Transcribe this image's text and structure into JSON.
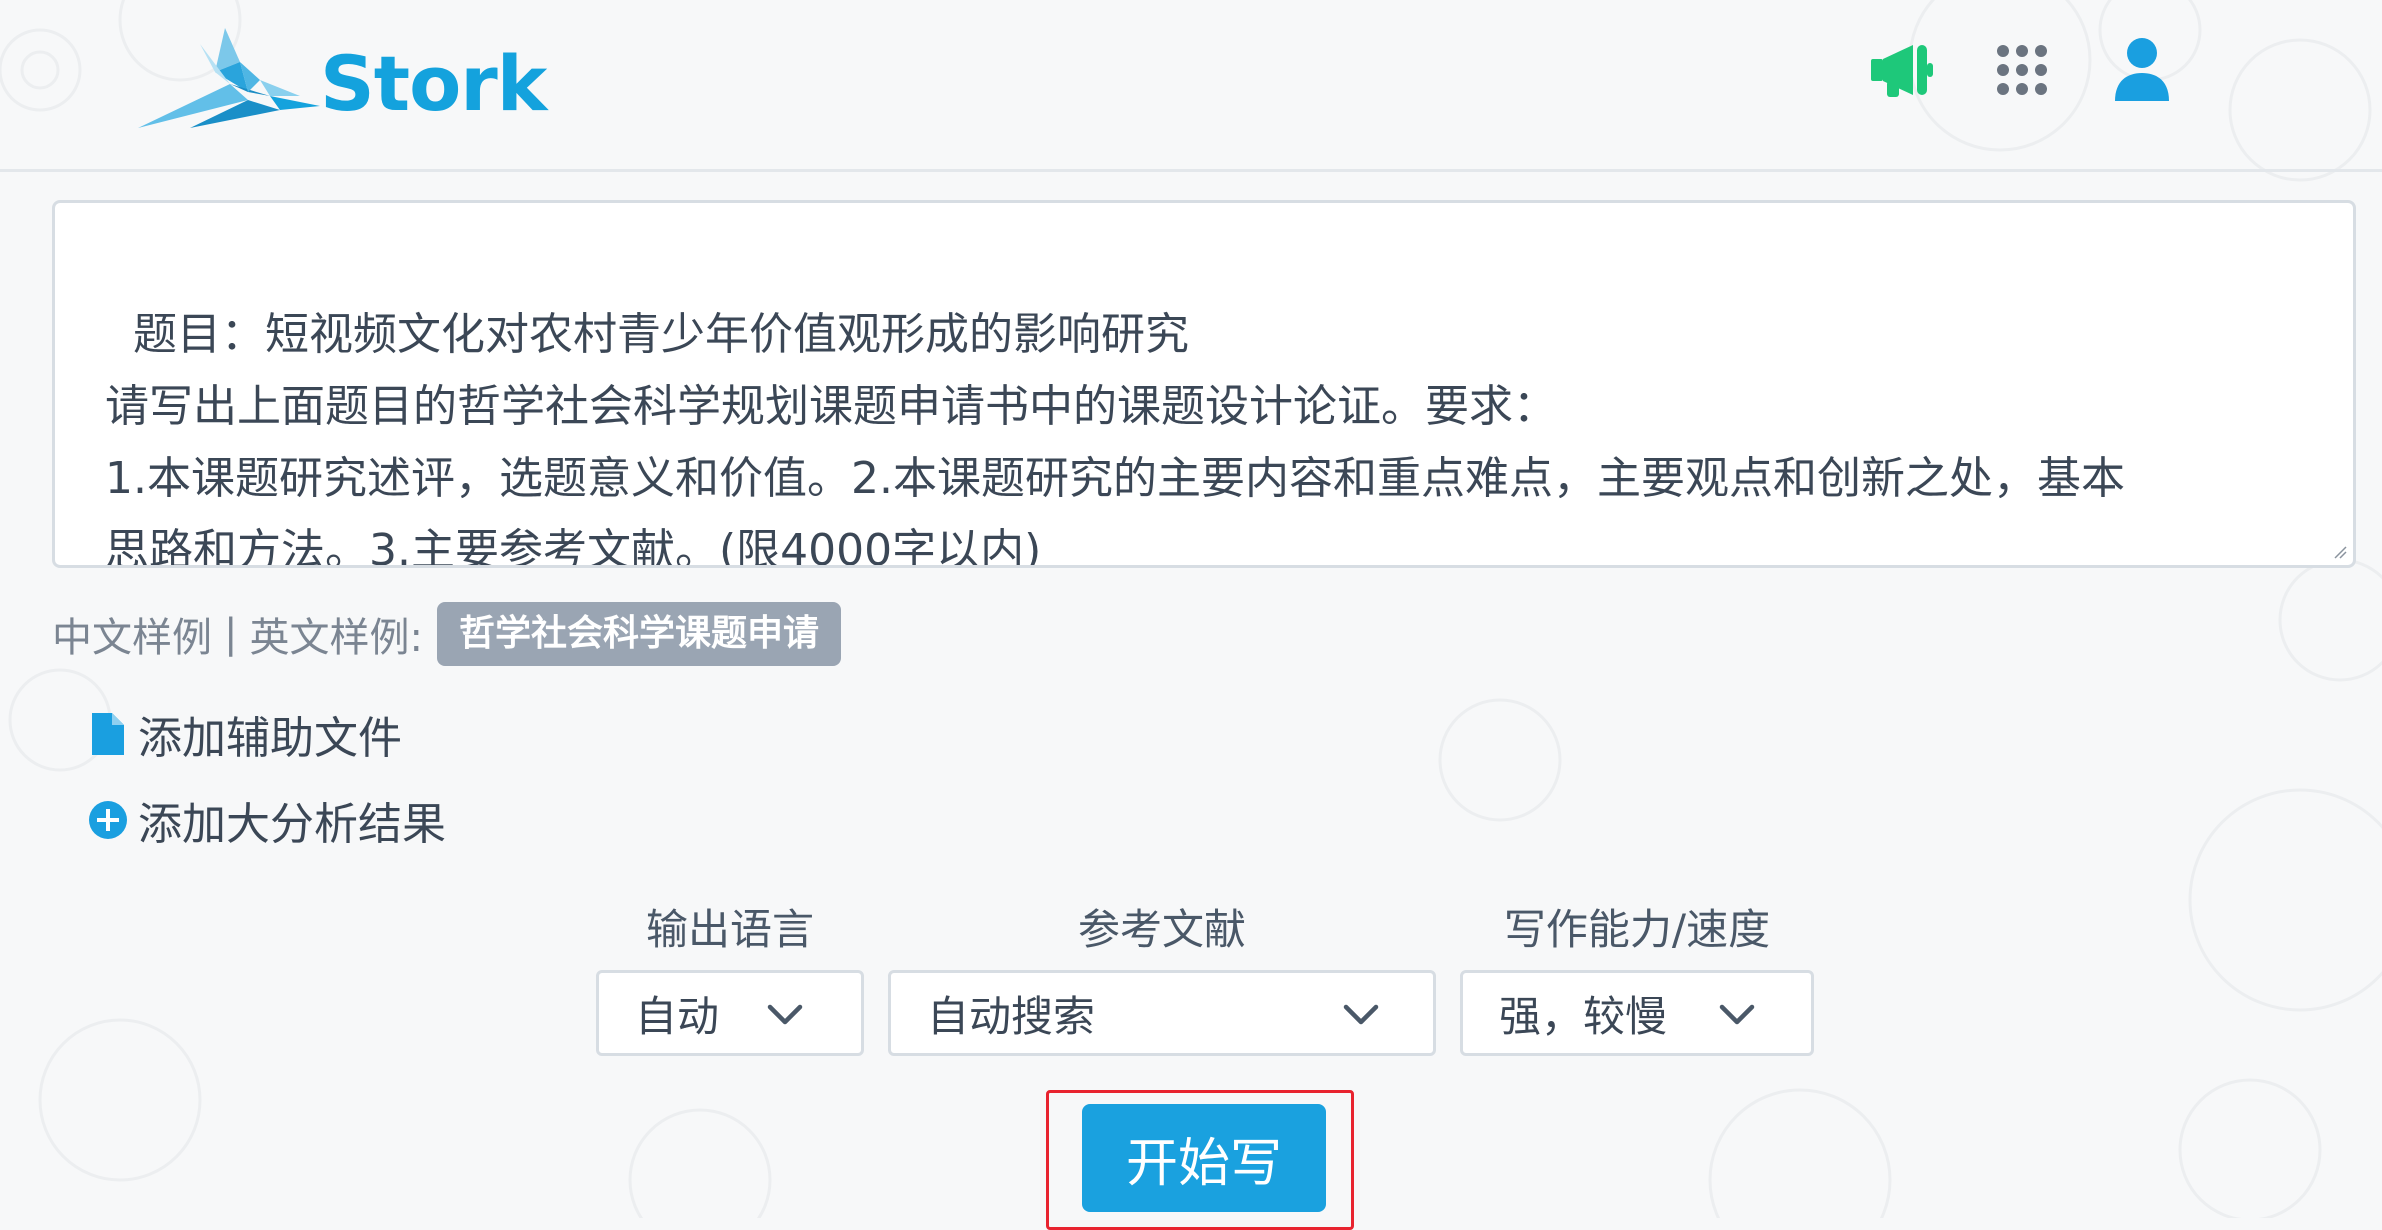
{
  "header": {
    "brand": "Stork",
    "brand_color": "#14a2dd",
    "icons": [
      "megaphone-icon",
      "apps-grid-icon",
      "user-icon"
    ],
    "megaphone_color": "#1ec87a",
    "grid_color": "#6b7480",
    "user_color": "#1a9fe0"
  },
  "prompt": {
    "text": "题目：短视频文化对农村青少年价值观形成的影响研究\n请写出上面题目的哲学社会科学规划课题申请书中的课题设计论证。要求：\n1.本课题研究述评，选题意义和价值。2.本课题研究的主要内容和重点难点，主要观点和创新之处，基本\n思路和方法。3.主要参考文献。(限4000字以内)"
  },
  "examples": {
    "chinese": "中文样例",
    "separator": "|",
    "english": "英文样例:",
    "tag": "哲学社会科学课题申请"
  },
  "actions": {
    "add_file": "添加辅助文件",
    "add_analysis": "添加大分析结果"
  },
  "options": {
    "language": {
      "label": "输出语言",
      "value": "自动"
    },
    "references": {
      "label": "参考文献",
      "value": "自动搜索"
    },
    "ability": {
      "label": "写作能力/速度",
      "value": "强，较慢"
    }
  },
  "start_button": "开始写",
  "colors": {
    "accent": "#1aa1df",
    "highlight": "#e8232f",
    "tag_bg": "#9aa5b3"
  }
}
